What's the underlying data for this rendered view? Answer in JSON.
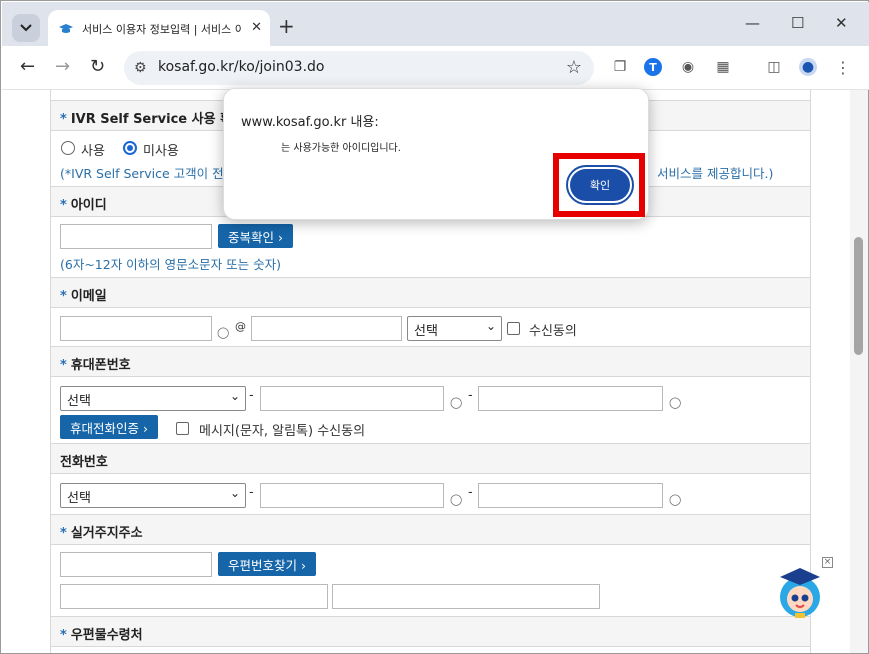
{
  "browser": {
    "tab_title": "서비스 이용자 정보입력 | 서비스 이용",
    "url": "kosaf.go.kr/ko/join03.do",
    "win_min": "—",
    "win_max": "☐",
    "win_close": "✕",
    "new_tab": "+",
    "tab_close": "✕"
  },
  "form": {
    "ivr": {
      "title": "IVR Self Service 사용 확인",
      "opt_use": "사용",
      "opt_nouse": "미사용",
      "note_left": "(*IVR Self Service 고객이 전화",
      "note_right": "서비스를 제공합니다.)"
    },
    "id": {
      "title": "아이디",
      "dup_check": "중복확인",
      "hint": "(6자~12자 이하의 영문소문자 또는 숫자)"
    },
    "email": {
      "title": "이메일",
      "at": "@",
      "select": "선택",
      "consent": "수신동의"
    },
    "mobile": {
      "title": "휴대폰번호",
      "select": "선택",
      "dash": "-",
      "verify": "휴대전화인증",
      "consent": "메시지(문자, 알림톡) 수신동의"
    },
    "phone": {
      "title": "전화번호",
      "select": "선택",
      "dash": "-"
    },
    "address": {
      "title": "실거주지주소",
      "find_zip": "우편번호찾기"
    },
    "mail": {
      "title": "우편물수령처"
    },
    "required_mark": "*"
  },
  "dialog": {
    "title": "www.kosaf.go.kr 내용:",
    "message": "는 사용가능한 아이디입니다.",
    "ok": "확인"
  },
  "colors": {
    "accent": "#1565a8",
    "hint": "#2b6fa7",
    "highlight": "#e60000"
  }
}
